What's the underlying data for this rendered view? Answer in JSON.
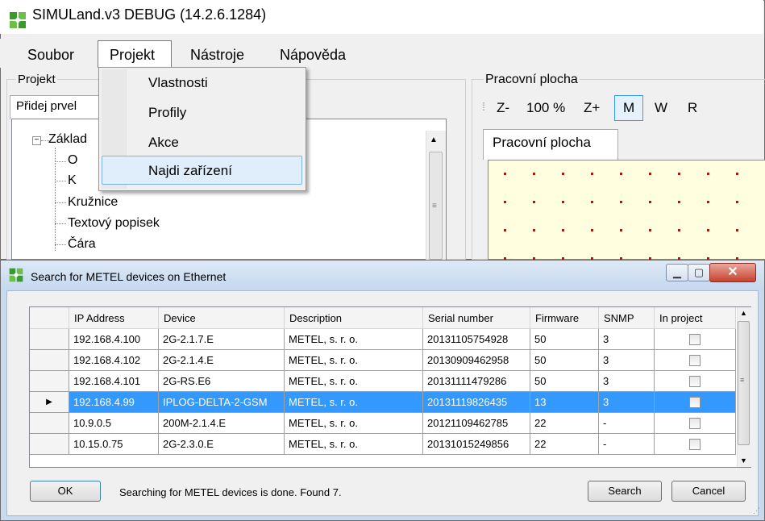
{
  "main": {
    "title": "SIMULand.v3 DEBUG  (14.2.6.1284)",
    "menu": [
      "Soubor",
      "Projekt",
      "Nástroje",
      "Nápověda"
    ],
    "projekt_label": "Projekt",
    "pridej_tab": "Přidej prvel",
    "tree": {
      "root": "Základ",
      "items": [
        "O",
        "K",
        "Kružnice",
        "Textový popisek",
        "Čára"
      ]
    },
    "dropdown": [
      "Vlastnosti",
      "Profily",
      "Akce",
      "Najdi zařízení"
    ],
    "workspace_label": "Pracovní plocha",
    "zoom": {
      "out": "Z-",
      "level": "100 %",
      "in": "Z+",
      "m": "M",
      "w": "W",
      "r": "R"
    },
    "workspace_tab": "Pracovní plocha",
    "canvas_color": "#ffffe0",
    "grid_dot_color": "#e00000"
  },
  "dialog": {
    "title": "Search for METEL devices on Ethernet",
    "columns": [
      "IP Address",
      "Device",
      "Description",
      "Serial number",
      "Firmware",
      "SNMP",
      "In project"
    ],
    "rows": [
      {
        "ip": "192.168.4.100",
        "device": "2G-2.1.7.E",
        "desc": "METEL, s. r. o.",
        "serial": "20131105754928",
        "fw": "50",
        "snmp": "3"
      },
      {
        "ip": "192.168.4.102",
        "device": "2G-2.1.4.E",
        "desc": "METEL, s. r. o.",
        "serial": "20130909462958",
        "fw": "50",
        "snmp": "3"
      },
      {
        "ip": "192.168.4.101",
        "device": "2G-RS.E6",
        "desc": "METEL, s. r. o.",
        "serial": "20131111479286",
        "fw": "50",
        "snmp": "3"
      },
      {
        "ip": "192.168.4.99",
        "device": "IPLOG-DELTA-2-GSM",
        "desc": "METEL, s. r. o.",
        "serial": "20131119826435",
        "fw": "13",
        "snmp": "3"
      },
      {
        "ip": "10.9.0.5",
        "device": "200M-2.1.4.E",
        "desc": "METEL, s. r. o.",
        "serial": "20121109462785",
        "fw": "22",
        "snmp": "-"
      },
      {
        "ip": "10.15.0.75",
        "device": "2G-2.3.0.E",
        "desc": "METEL, s. r. o.",
        "serial": "20131015249856",
        "fw": "22",
        "snmp": "-"
      }
    ],
    "selected_row": 3,
    "ok_label": "OK",
    "status": "Searching for METEL devices is done. Found 7.",
    "search_label": "Search",
    "cancel_label": "Cancel",
    "selection_color": "#3399ff"
  }
}
